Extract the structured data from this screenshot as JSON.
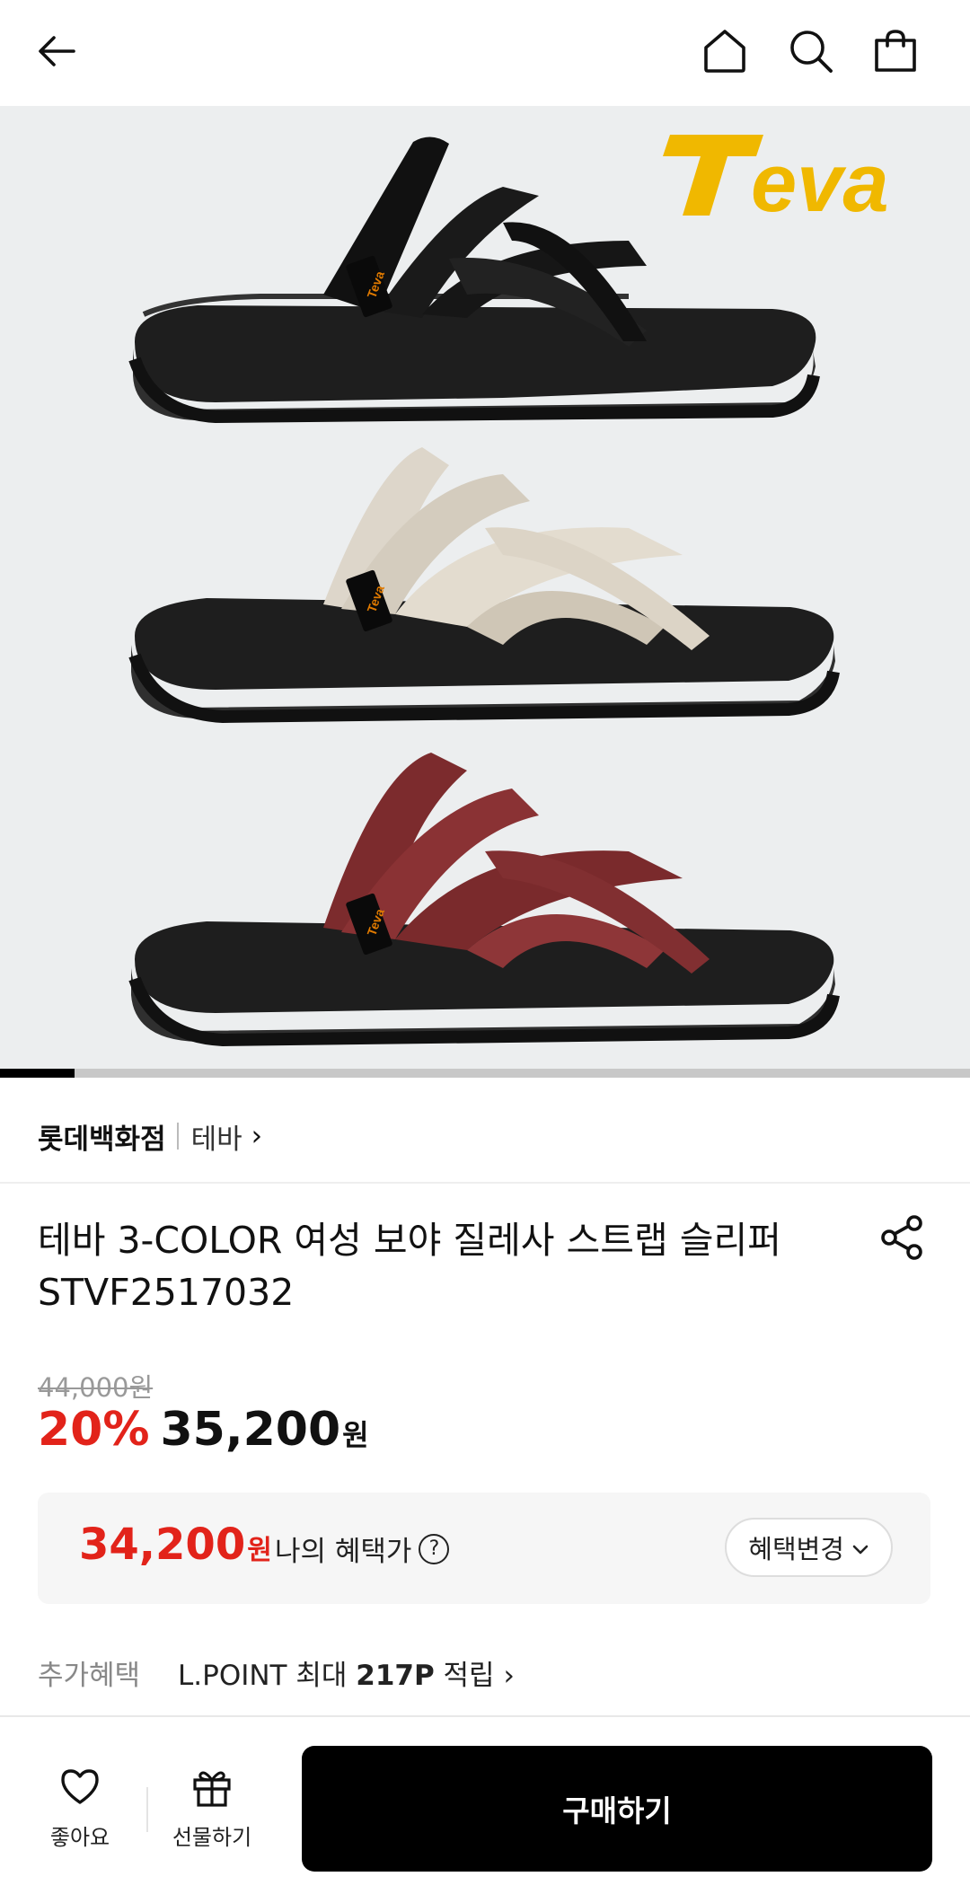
{
  "header": {
    "icons": [
      "back-arrow-icon",
      "home-icon",
      "search-icon",
      "shopping-bag-icon"
    ]
  },
  "hero": {
    "logo_text": "Teva",
    "brand_color": "#f0b800",
    "product_colors": [
      "black",
      "beige",
      "burgundy"
    ],
    "gallery_progress": 0.077
  },
  "seller": {
    "store": "롯데백화점",
    "brand": "테바",
    "chevron": "›"
  },
  "product": {
    "title_line1": "테바 3-COLOR 여성 보야 질레사 스트랩 슬리퍼",
    "title_line2": "STVF2517032"
  },
  "price": {
    "original": "44,000원",
    "discount": "20%",
    "sale": "35,200",
    "currency": "원",
    "accent": "#e2231a"
  },
  "benefit": {
    "price": "34,200",
    "currency": "원",
    "label": "나의 혜택가",
    "help": "?",
    "change_label": "혜택변경",
    "change_chevron": "⌄"
  },
  "extra": {
    "label": "추가혜택",
    "value_prefix": "L.POINT 최대 ",
    "value_bold": "217P",
    "value_suffix": " 적립",
    "chevron": "›"
  },
  "bottom": {
    "like_label": "좋아요",
    "gift_label": "선물하기",
    "buy_label": "구매하기"
  }
}
